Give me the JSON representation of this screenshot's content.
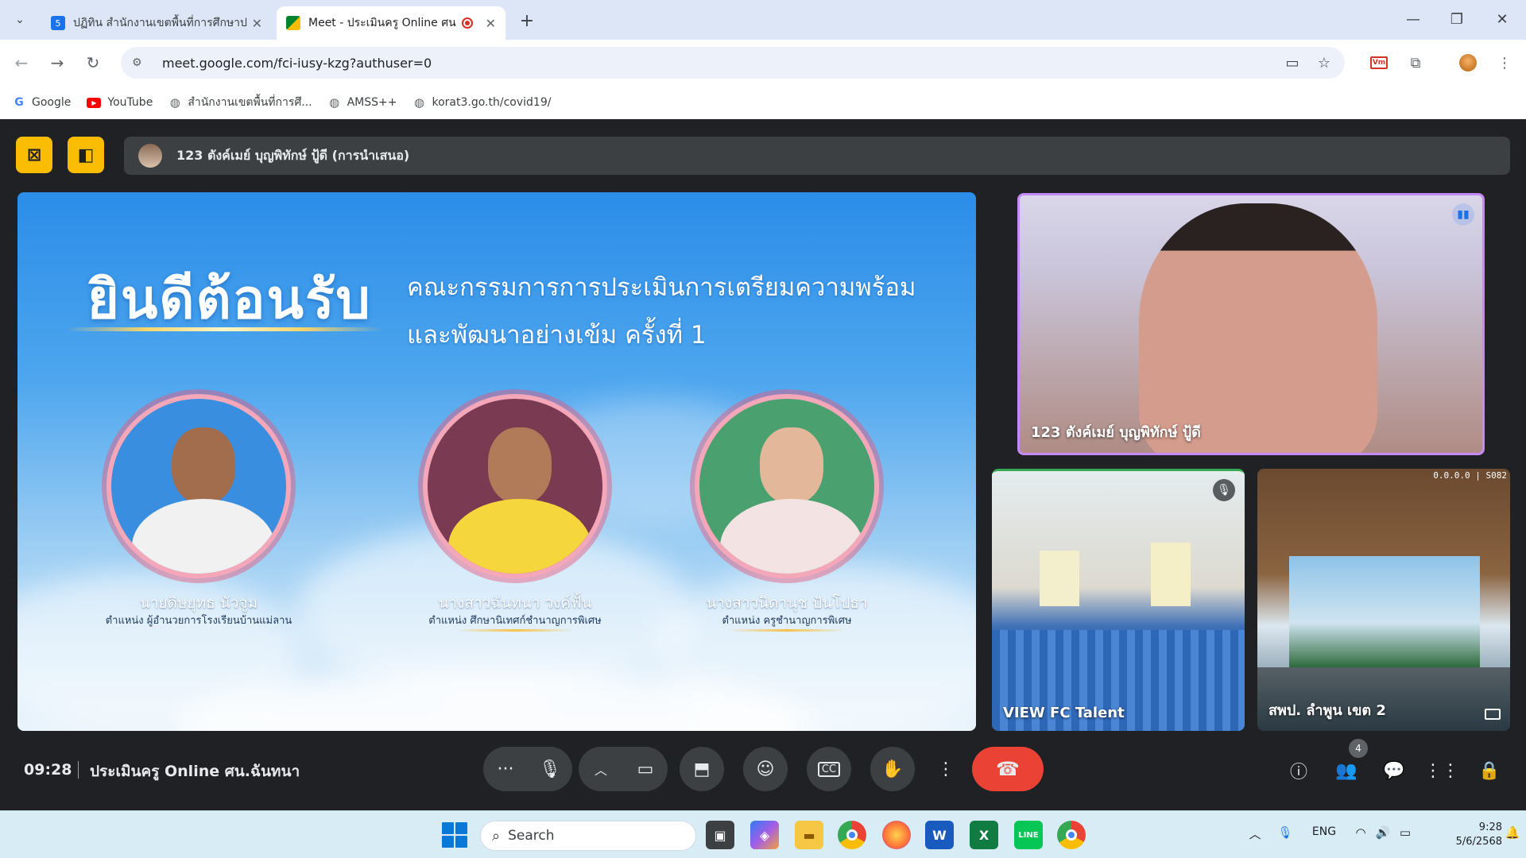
{
  "browser": {
    "tabs": [
      {
        "title": "ปฏิทิน สำนักงานเขตพื้นที่การศึกษาป"
      },
      {
        "title": "Meet - ประเมินครู Online ศน.ฉ"
      }
    ],
    "url": "meet.google.com/fci-iusy-kzg?authuser=0",
    "bookmarks": [
      {
        "label": "Google",
        "icon": "google-icon"
      },
      {
        "label": "YouTube",
        "icon": "youtube-icon"
      },
      {
        "label": "สำนักงานเขตพื้นที่การศึ...",
        "icon": "globe-icon"
      },
      {
        "label": "AMSS++",
        "icon": "globe-icon"
      },
      {
        "label": "korat3.go.th/covid19/",
        "icon": "globe-icon"
      }
    ]
  },
  "meet": {
    "presenting_banner": "123 ตังค์เมย์ บุญพิทักษ์ ปู้ดี (การนำเสนอ)",
    "slide": {
      "welcome": "ยินดีต้อนรับ",
      "subtitle_line1": "คณะกรรมการการประเมินการเตรียมความพร้อม",
      "subtitle_line2": "และพัฒนาอย่างเข้ม ครั้งที่ 1",
      "people": [
        {
          "name": "นายดิษยุทธ นัวจูม",
          "position": "ตำแหน่ง ผู้อำนวยการโรงเรียนบ้านแม่ลาน"
        },
        {
          "name": "นางสาวฉันทนา วงค์ฟั้น",
          "position": "ตำแหน่ง ศึกษานิเทศก์ชำนาญการพิเศษ"
        },
        {
          "name": "นางสาวนิดานุช ปันโปธา",
          "position": "ตำแหน่ง ครูชำนาญการพิเศษ"
        }
      ]
    },
    "tiles": [
      {
        "name": "123 ตังค์เมย์ บุญพิทักษ์ ปู้ดี"
      },
      {
        "name": "VIEW FC Talent"
      },
      {
        "name": "สพป. ลำพูน เขต 2",
        "overlay_text": "0.0.0.0 | S082"
      }
    ],
    "time": "09:28",
    "meeting_name": "ประเมินครู Online ศน.ฉันทนา",
    "participants_count": "4"
  },
  "taskbar": {
    "search_placeholder": "Search",
    "language": "ENG",
    "time": "9:28",
    "date": "5/6/2568"
  },
  "colors": {
    "meet_bg": "#202124",
    "control_bg": "#3c4043",
    "hangup": "#ea4335",
    "accent_yellow": "#fbbc04"
  }
}
